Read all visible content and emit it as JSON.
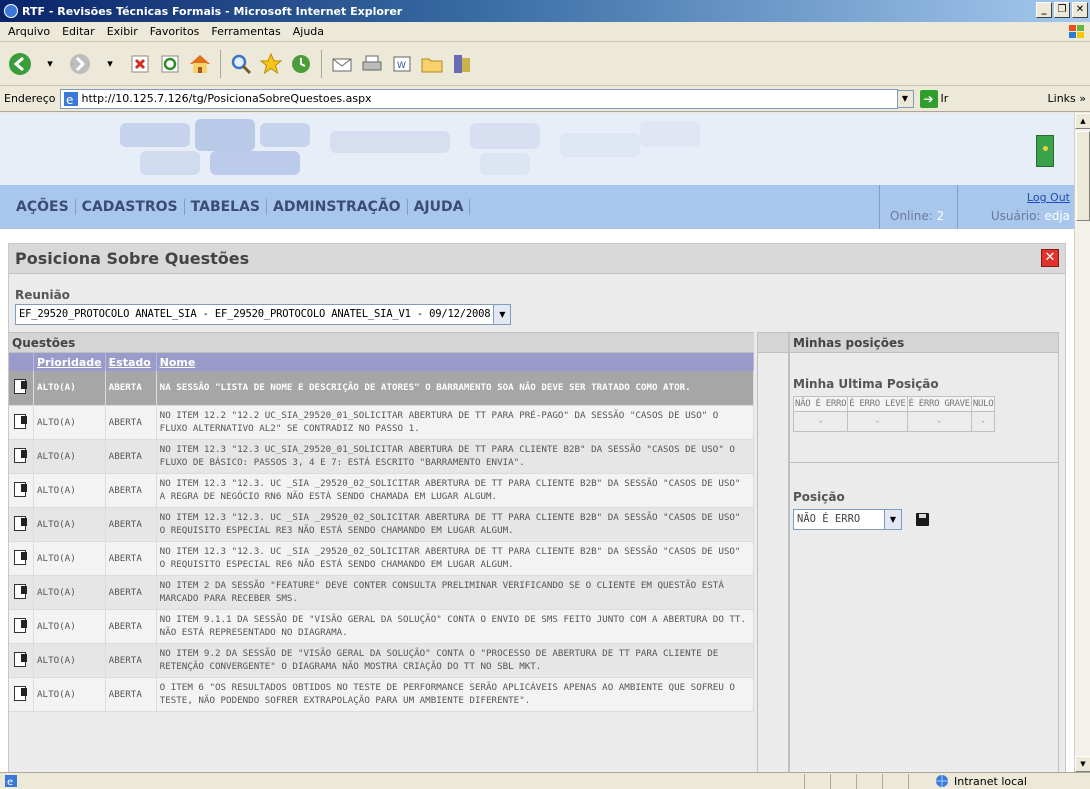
{
  "window": {
    "title": "RTF - Revisões Técnicas Formais - Microsoft Internet Explorer",
    "minimize": "_",
    "maximize": "❐",
    "close": "✕"
  },
  "menu": [
    "Arquivo",
    "Editar",
    "Exibir",
    "Favoritos",
    "Ferramentas",
    "Ajuda"
  ],
  "address": {
    "label": "Endereço",
    "url": "http://10.125.7.126/tg/PosicionaSobreQuestoes.aspx",
    "go": "Ir",
    "links": "Links »"
  },
  "site": {
    "nav": [
      "AÇÕES",
      "CADASTROS",
      "TABELAS",
      "ADMINSTRAÇÃO",
      "AJUDA"
    ],
    "online_label": "Online:",
    "online_value": "2",
    "logout": "Log Out",
    "user_label": "Usuário:",
    "user_value": "edja"
  },
  "panel": {
    "title": "Posiciona Sobre Questões",
    "close": "✕",
    "reuniao_label": "Reunião",
    "reuniao_value": "EF_29520_PROTOCOLO ANATEL_SIA - EF_29520_PROTOCOLO ANATEL_SIA_V1 - 09/12/2008",
    "questoes_label": "Questões",
    "columns": {
      "prioridade": "Prioridade",
      "estado": "Estado",
      "nome": "Nome"
    },
    "rows": [
      {
        "prioridade": "ALTO(A)",
        "estado": "ABERTA",
        "nome": "NA SESSÃO \"LISTA DE NOME E DESCRIÇÃO DE ATORES\" O BARRAMENTO SOA NÃO DEVE SER TRATADO COMO ATOR."
      },
      {
        "prioridade": "ALTO(A)",
        "estado": "ABERTA",
        "nome": "NO ITEM 12.2 \"12.2 UC_SIA_29520_01_SOLICITAR ABERTURA DE TT PARA PRÉ-PAGO\" DA SESSÃO \"CASOS DE USO\" O FLUXO ALTERNATIVO AL2\" SE CONTRADIZ NO PASSO 1."
      },
      {
        "prioridade": "ALTO(A)",
        "estado": "ABERTA",
        "nome": "NO ITEM 12.3 \"12.3 UC_SIA_29520_01_SOLICITAR ABERTURA DE TT PARA CLIENTE B2B\" DA SESSÃO \"CASOS DE USO\" O FLUXO DE BÁSICO: PASSOS 3, 4 E 7: ESTÁ ESCRITO \"BARRAMENTO ENVIA\"."
      },
      {
        "prioridade": "ALTO(A)",
        "estado": "ABERTA",
        "nome": "NO ITEM 12.3 \"12.3. UC _SIA _29520_02_SOLICITAR ABERTURA DE TT PARA CLIENTE B2B\" DA SESSÃO \"CASOS DE USO\" A REGRA DE NEGÓCIO RN6 NÃO ESTÁ SENDO CHAMADA EM LUGAR ALGUM."
      },
      {
        "prioridade": "ALTO(A)",
        "estado": "ABERTA",
        "nome": "NO ITEM 12.3 \"12.3. UC _SIA _29520_02_SOLICITAR ABERTURA DE TT PARA CLIENTE B2B\" DA SESSÃO \"CASOS DE USO\" O REQUISITO ESPECIAL RE3 NÃO ESTÁ SENDO CHAMANDO EM LUGAR ALGUM."
      },
      {
        "prioridade": "ALTO(A)",
        "estado": "ABERTA",
        "nome": "NO ITEM 12.3 \"12.3. UC _SIA _29520_02_SOLICITAR ABERTURA DE TT PARA CLIENTE B2B\" DA SESSÃO \"CASOS DE USO\" O REQUISITO ESPECIAL RE6 NÃO ESTÁ SENDO CHAMANDO EM LUGAR ALGUM."
      },
      {
        "prioridade": "ALTO(A)",
        "estado": "ABERTA",
        "nome": "NO ITEM 2 DA SESSÃO \"FEATURE\" DEVE CONTER CONSULTA PRELIMINAR VERIFICANDO SE O CLIENTE EM QUESTÃO ESTÁ MARCADO PARA RECEBER SMS."
      },
      {
        "prioridade": "ALTO(A)",
        "estado": "ABERTA",
        "nome": "NO ITEM 9.1.1 DA SESSÃO DE \"VISÃO GERAL DA SOLUÇÃO\" CONTA O ENVIO DE SMS FEITO JUNTO COM A ABERTURA DO TT. NÃO ESTÁ REPRESENTADO NO DIAGRAMA."
      },
      {
        "prioridade": "ALTO(A)",
        "estado": "ABERTA",
        "nome": "NO ITEM 9.2 DA SESSÃO DE \"VISÃO GERAL DA SOLUÇÃO\" CONTA O \"PROCESSO DE ABERTURA DE TT PARA CLIENTE DE RETENÇÃO CONVERGENTE\" O DIAGRAMA NÃO MOSTRA CRIAÇÃO DO TT NO SBL MKT."
      },
      {
        "prioridade": "ALTO(A)",
        "estado": "ABERTA",
        "nome": "O ITEM 6 \"OS RESULTADOS OBTIDOS NO TESTE DE PERFORMANCE SERÃO APLICÁVEIS APENAS AO AMBIENTE QUE SOFREU O TESTE, NÃO PODENDO SOFRER EXTRAPOLAÇÃO PARA UM AMBIENTE DIFERENTE\"."
      }
    ],
    "minhas_posicoes": "Minhas posições",
    "minha_ultima": "Minha Ultima Posição",
    "ultima_cols": [
      "NÃO É ERRO",
      "É ERRO LEVE",
      "É ERRO GRAVE",
      "NULO"
    ],
    "ultima_vals": [
      "-",
      "-",
      "-",
      "-"
    ],
    "posicao_label": "Posição",
    "posicao_value": "NÃO É ERRO"
  },
  "status": {
    "zone": "Intranet local"
  }
}
